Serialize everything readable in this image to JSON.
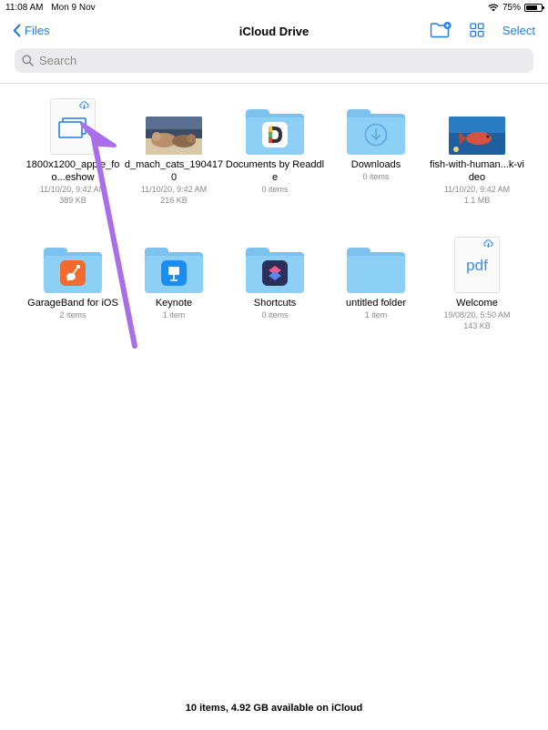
{
  "status": {
    "time": "11:08 AM",
    "date": "Mon 9 Nov",
    "battery": "75%",
    "battery_level": 0.75
  },
  "nav": {
    "back_label": "Files",
    "title": "iCloud Drive",
    "select_label": "Select"
  },
  "search": {
    "placeholder": "Search"
  },
  "items": [
    {
      "name": "1800x1200_apple_foo...eshow",
      "date": "11/10/20, 9:42 AM",
      "size": "389 KB"
    },
    {
      "name": "d_mach_cats_1904170",
      "date": "11/10/20, 9:42 AM",
      "size": "216 KB"
    },
    {
      "name": "Documents by Readdle",
      "count": "0 items"
    },
    {
      "name": "Downloads",
      "count": "0 items"
    },
    {
      "name": "fish-with-human...k-video",
      "date": "11/10/20, 9:42 AM",
      "size": "1.1 MB"
    },
    {
      "name": "GarageBand for iOS",
      "count": "2 items"
    },
    {
      "name": "Keynote",
      "count": "1 item"
    },
    {
      "name": "Shortcuts",
      "count": "0 items"
    },
    {
      "name": "untitled folder",
      "count": "1 item"
    },
    {
      "name": "Welcome",
      "date": "19/08/20, 5:50 AM",
      "size": "143 KB",
      "thumb_text": "pdf"
    }
  ],
  "footer": {
    "summary": "10 items, 4.92 GB available on iCloud"
  },
  "colors": {
    "accent": "#1a7cf2",
    "folder": "#8dd0f6",
    "arrow": "#a96ee8"
  }
}
